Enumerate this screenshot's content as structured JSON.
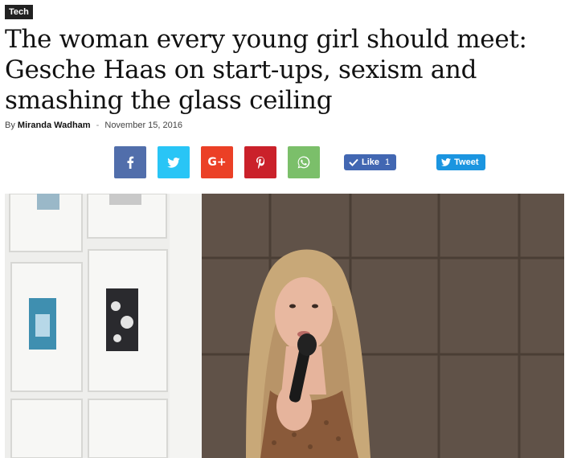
{
  "article": {
    "category": "Tech",
    "title": "The woman every young girl should meet: Gesche Haas on start-ups, sexism and smashing the glass ceiling",
    "byline_prefix": "By",
    "author": "Miranda Wadham",
    "separator": "-",
    "date": "November 15, 2016"
  },
  "share": {
    "buttons": [
      {
        "name": "facebook",
        "icon": "facebook-icon",
        "color": "#516eab"
      },
      {
        "name": "twitter",
        "icon": "twitter-icon",
        "color": "#29c5f6"
      },
      {
        "name": "google-plus",
        "icon": "google-plus-icon",
        "color": "#eb4026",
        "label": "G+"
      },
      {
        "name": "pinterest",
        "icon": "pinterest-icon",
        "color": "#ca212a"
      },
      {
        "name": "whatsapp",
        "icon": "whatsapp-icon",
        "color": "#7bbf6a"
      }
    ],
    "like_label": "Like",
    "like_count": "1",
    "tweet_label": "Tweet"
  },
  "hero_image": {
    "icon": "photo-of-speaker-with-microphone"
  }
}
